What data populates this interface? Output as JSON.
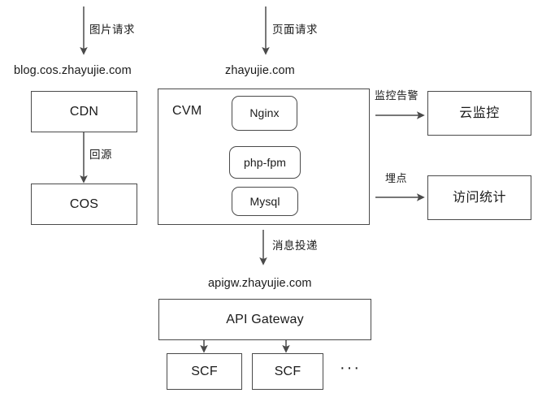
{
  "diagram": {
    "title": "Cloud architecture diagram",
    "background_color": "#ffffff",
    "stroke_color": "#4a4a4a",
    "text_color": "#1a1a1a"
  },
  "entrypoints": [
    {
      "arrow_label": "图片请求",
      "domain": "blog.cos.zhayujie.com"
    },
    {
      "arrow_label": "页面请求",
      "domain": "zhayujie.com"
    }
  ],
  "nodes": {
    "cdn": "CDN",
    "cos": "COS",
    "cvm": "CVM",
    "nginx": "Nginx",
    "php_fpm": "php-fpm",
    "mysql": "Mysql",
    "cloud_monitor": "云监控",
    "visit_stats": "访问统计",
    "api_gateway": "API Gateway",
    "scf_1": "SCF",
    "scf_2": "SCF",
    "scf_more": "···"
  },
  "edges": {
    "cdn_to_cos": "回源",
    "cvm_to_monitor": "监控告警",
    "cvm_to_stats": "埋点",
    "cvm_to_apigw": "消息投递"
  },
  "domains": {
    "apigw": "apigw.zhayujie.com"
  }
}
